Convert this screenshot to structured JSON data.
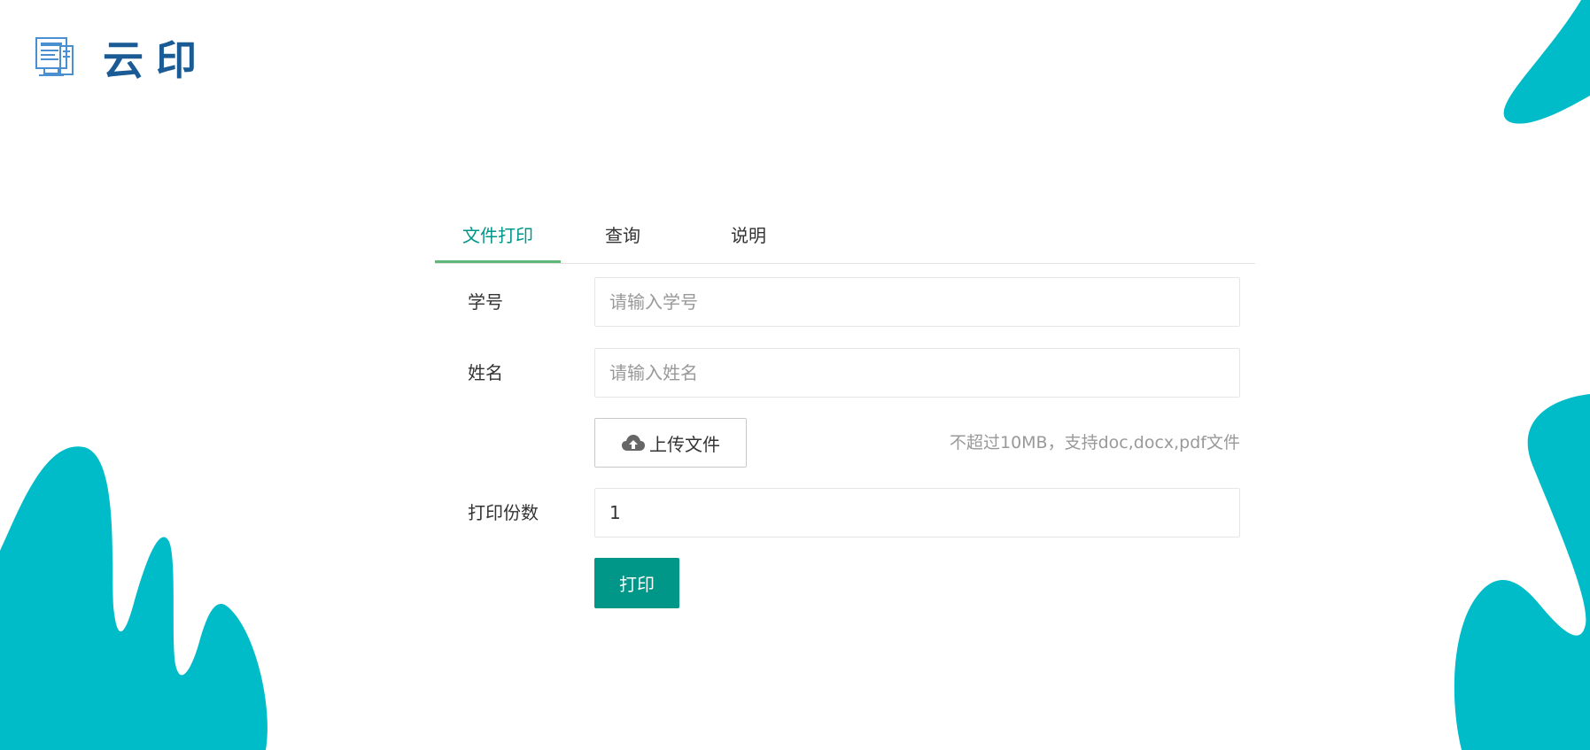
{
  "brand": {
    "name": "云印",
    "icon": "printer-document-icon",
    "color": "#1a5b96"
  },
  "theme": {
    "accent": "#009688",
    "tab_underline": "#5FB878",
    "decoration": "#00BCC8"
  },
  "tabs": [
    {
      "label": "文件打印",
      "active": true
    },
    {
      "label": "查询",
      "active": false
    },
    {
      "label": "说明",
      "active": false
    }
  ],
  "form": {
    "student_id": {
      "label": "学号",
      "placeholder": "请输入学号",
      "value": ""
    },
    "name": {
      "label": "姓名",
      "placeholder": "请输入姓名",
      "value": ""
    },
    "upload": {
      "label": "上传文件",
      "icon": "cloud-upload-icon",
      "hint": "不超过10MB，支持doc,docx,pdf文件"
    },
    "copies": {
      "label": "打印份数",
      "value": "1"
    },
    "submit_label": "打印"
  }
}
